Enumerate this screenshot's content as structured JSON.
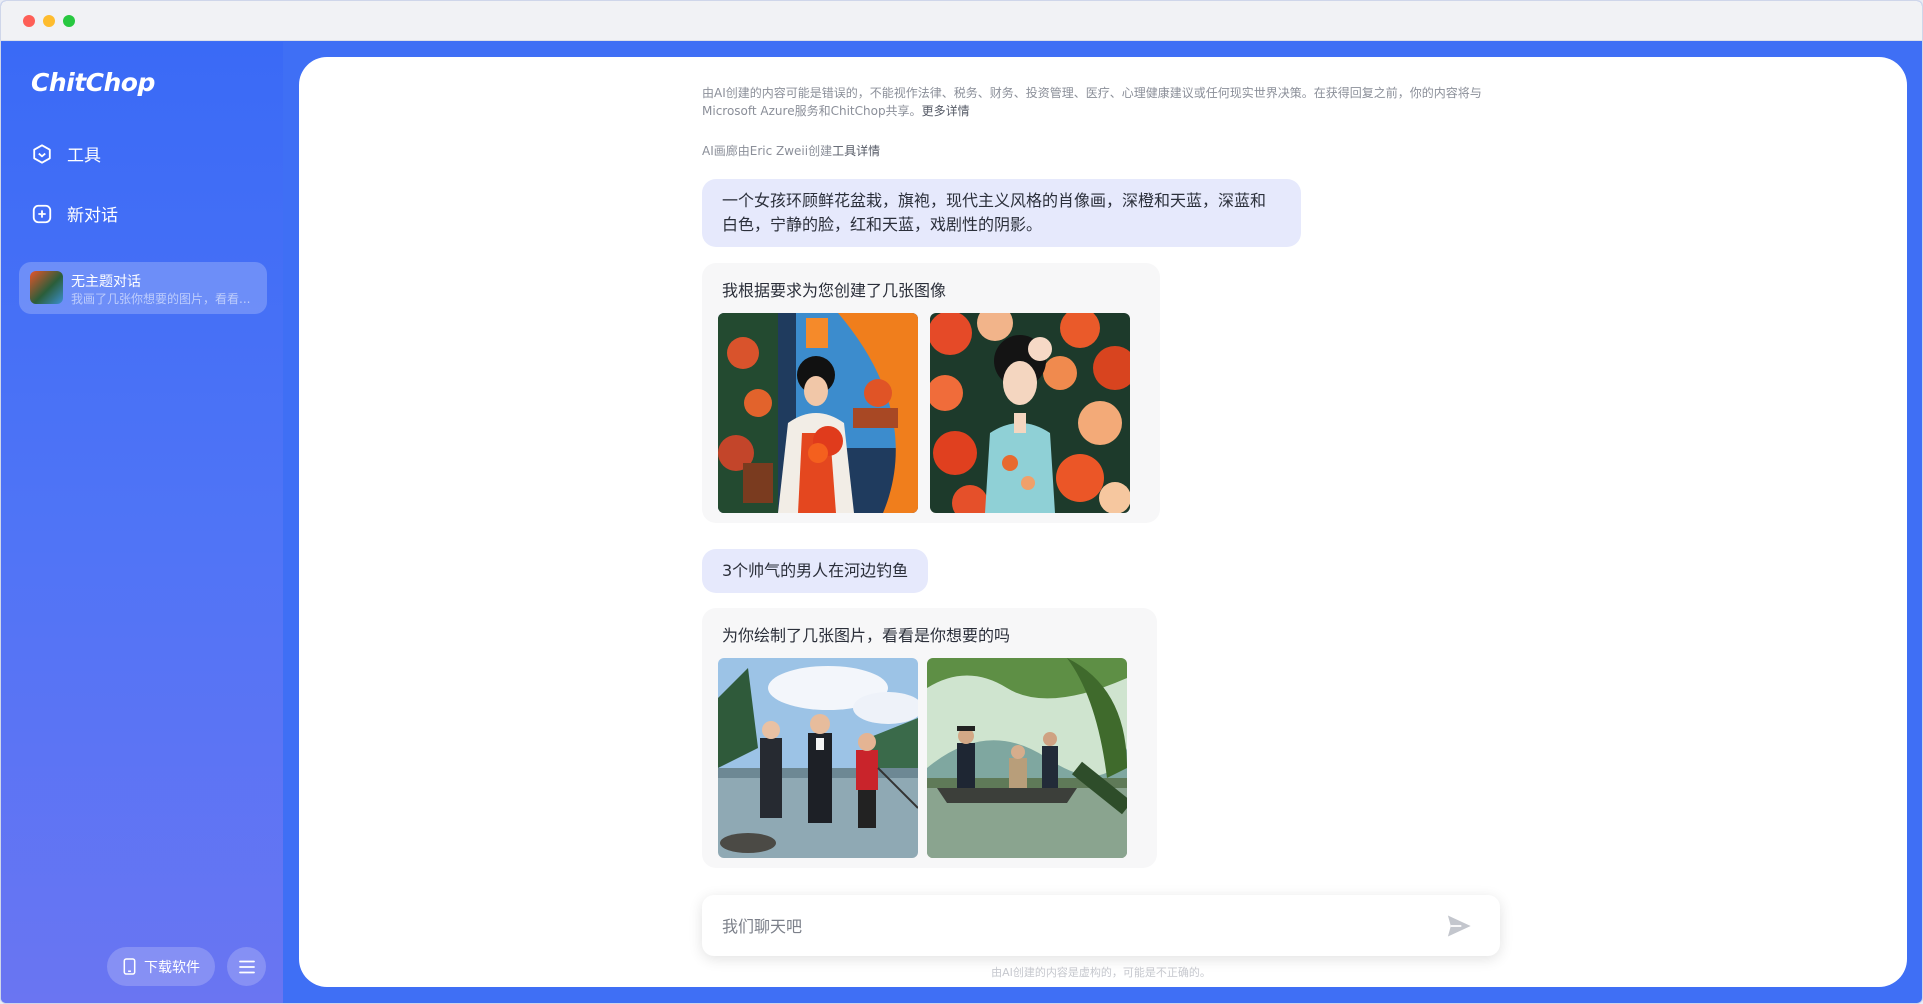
{
  "app": {
    "name": "ChitChop"
  },
  "sidebar": {
    "nav": [
      {
        "label": "工具",
        "icon": "hexagon-check-icon"
      },
      {
        "label": "新对话",
        "icon": "plus-square-icon"
      }
    ],
    "conversation": {
      "title": "无主题对话",
      "preview": "我画了几张你想要的图片，看看..."
    },
    "download_label": "下载软件"
  },
  "chat": {
    "disclaimer_text": "由AI创建的内容可能是错误的，不能视作法律、税务、财务、投资管理、医疗、心理健康建议或任何现实世界决策。在获得回复之前，你的内容将与Microsoft Azure服务和ChitChop共享。",
    "disclaimer_link": "更多详情",
    "credit_text": "AI画廊由Eric Zweii创建",
    "credit_link": "工具详情",
    "messages": [
      {
        "role": "user",
        "text": "一个女孩环顾鲜花盆栽，旗袍，现代主义风格的肖像画，深橙和天蓝，深蓝和白色，宁静的脸，红和天蓝，戏剧性的阴影。"
      },
      {
        "role": "assistant",
        "text": "我根据要求为您创建了几张图像"
      },
      {
        "role": "user",
        "text": "3个帅气的男人在河边钓鱼"
      },
      {
        "role": "assistant",
        "text": "为你绘制了几张图片，看看是你想要的吗"
      }
    ]
  },
  "input": {
    "placeholder": "我们聊天吧"
  },
  "footnote": "由AI创建的内容是虚构的，可能是不正确的。",
  "colors": {
    "brand_blue": "#3f6ff5",
    "user_bubble": "#e6e9fc",
    "ai_bubble": "#f7f7f8"
  }
}
